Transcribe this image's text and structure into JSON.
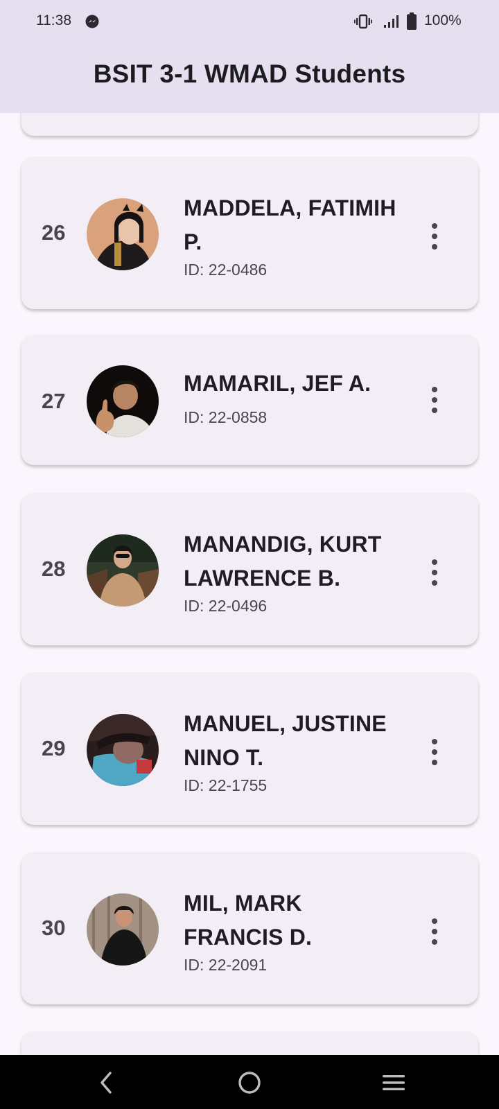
{
  "status": {
    "time": "11:38",
    "battery": "100%",
    "icons": [
      "messenger-icon",
      "vibrate-icon",
      "signal-icon",
      "battery-icon"
    ]
  },
  "app_bar": {
    "title": "BSIT 3-1 WMAD Students"
  },
  "students": [
    {
      "number": "26",
      "name_line1": "MADDELA, FATIMIH",
      "name_line2": "P.",
      "id": "ID: 22-0486"
    },
    {
      "number": "27",
      "name_line1": "MAMARIL, JEF A.",
      "name_line2": "",
      "id": "ID: 22-0858"
    },
    {
      "number": "28",
      "name_line1": "MANANDIG, KURT",
      "name_line2": "LAWRENCE B.",
      "id": "ID: 22-0496"
    },
    {
      "number": "29",
      "name_line1": "MANUEL, JUSTINE",
      "name_line2": "NINO T.",
      "id": "ID: 22-1755"
    },
    {
      "number": "30",
      "name_line1": "MIL, MARK",
      "name_line2": "FRANCIS D.",
      "id": "ID: 22-2091"
    }
  ],
  "nav": {
    "icons": [
      "back-icon",
      "home-icon",
      "recents-icon"
    ]
  },
  "colors": {
    "app_bar": "#e6dfef",
    "card": "#f3eef6",
    "background": "#fbf6fd"
  }
}
